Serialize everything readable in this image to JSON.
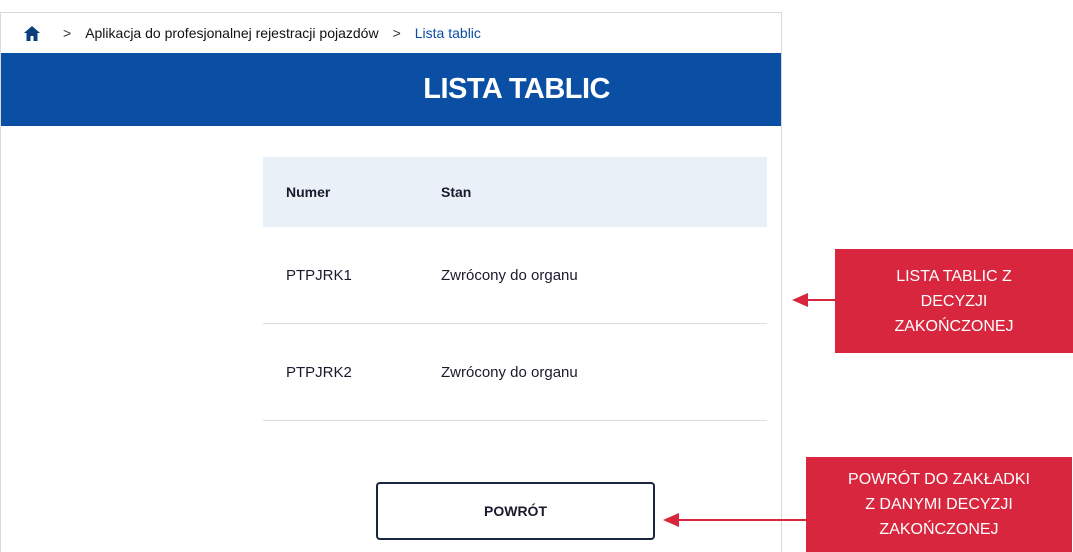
{
  "breadcrumb": {
    "home_icon": "home-icon",
    "separator": ">",
    "app_link": "Aplikacja do profesjonalnej rejestracji pojazdów",
    "current": "Lista tablic"
  },
  "header": {
    "title": "LISTA TABLIC"
  },
  "table": {
    "columns": [
      "Numer",
      "Stan"
    ],
    "rows": [
      {
        "numer": "PTPJRK1",
        "stan": "Zwrócony do organu"
      },
      {
        "numer": "PTPJRK2",
        "stan": "Zwrócony do organu"
      }
    ]
  },
  "actions": {
    "back_label": "POWRÓT"
  },
  "callouts": {
    "list": [
      "LISTA TABLIC Z",
      "DECYZJI",
      "ZAKOŃCZONEJ"
    ],
    "back": [
      "POWRÓT DO ZAKŁADKI",
      "Z DANYMI DECYZJI",
      "ZAKOŃCZONEJ"
    ]
  },
  "colors": {
    "header_bg": "#0b4fa4",
    "callout_bg": "#d7263d",
    "table_header_bg": "#eaf0f7",
    "link_current": "#0a4ea3"
  }
}
